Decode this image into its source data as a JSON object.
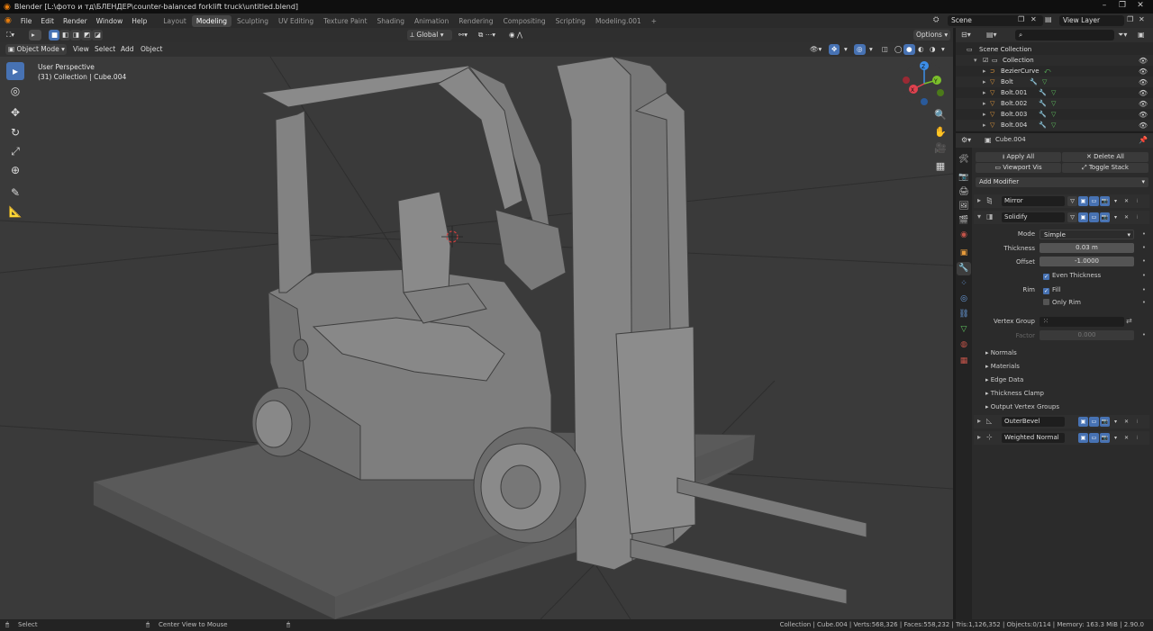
{
  "window": {
    "title": "Blender [L:\\фото и тд\\БЛЕНДЕР\\counter-balanced forklift truck\\untitled.blend]",
    "controls": [
      "–",
      "❐",
      "✕"
    ]
  },
  "menu": [
    "File",
    "Edit",
    "Render",
    "Window",
    "Help"
  ],
  "workspaces": [
    "Layout",
    "Modeling",
    "Sculpting",
    "UV Editing",
    "Texture Paint",
    "Shading",
    "Animation",
    "Rendering",
    "Compositing",
    "Scripting",
    "Modeling.001"
  ],
  "active_workspace": "Modeling",
  "add_workspace": "+",
  "scene": {
    "name": "Scene",
    "view_layer": "View Layer"
  },
  "viewport_header": {
    "orientation": "Global",
    "options": "Options"
  },
  "viewport_header2": {
    "mode": "Object Mode",
    "menus": [
      "View",
      "Select",
      "Add",
      "Object"
    ]
  },
  "viewport": {
    "perspective": "User Perspective",
    "collection_info": "(31) Collection | Cube.004",
    "gizmo_axes": {
      "z": "Z",
      "y": "Y",
      "x": "X"
    }
  },
  "outliner": {
    "root": "Scene Collection",
    "items": [
      {
        "name": "Collection",
        "level": 1
      },
      {
        "name": "BezierCurve",
        "level": 2
      },
      {
        "name": "Bolt",
        "level": 2
      },
      {
        "name": "Bolt.001",
        "level": 2
      },
      {
        "name": "Bolt.002",
        "level": 2
      },
      {
        "name": "Bolt.003",
        "level": 2
      },
      {
        "name": "Bolt.004",
        "level": 2
      }
    ]
  },
  "properties": {
    "object_name": "Cube.004",
    "apply_all": "Apply All",
    "delete_all": "Delete All",
    "viewport_vis": "Viewport Vis",
    "toggle_stack": "Toggle Stack",
    "add_modifier": "Add Modifier",
    "modifiers": {
      "mirror": "Mirror",
      "solidify": "Solidify",
      "outer_bevel": "OuterBevel",
      "weighted_normal": "Weighted Normal"
    },
    "solidify": {
      "mode_label": "Mode",
      "mode_value": "Simple",
      "thickness_label": "Thickness",
      "thickness_value": "0.03 m",
      "offset_label": "Offset",
      "offset_value": "-1.0000",
      "even_thickness": "Even Thickness",
      "rim_label": "Rim",
      "fill": "Fill",
      "only_rim": "Only Rim",
      "vertex_group_label": "Vertex Group",
      "factor_label": "Factor",
      "factor_value": "0.000"
    },
    "subpanels": [
      "Normals",
      "Materials",
      "Edge Data",
      "Thickness Clamp",
      "Output Vertex Groups"
    ]
  },
  "statusbar": {
    "select": "Select",
    "center_view": "Center View to Mouse",
    "stats": "Collection | Cube.004 | Verts:568,326 | Faces:558,232 | Tris:1,126,352 | Objects:0/114 | Memory: 163.3 MiB | 2.90.0"
  },
  "colors": {
    "accent": "#4772b3",
    "axis_x": "#e0424f",
    "axis_y": "#7bbf2a",
    "axis_z": "#3c8ee8",
    "object_orange": "#e59a3b",
    "mesh_green": "#5fc35f"
  }
}
